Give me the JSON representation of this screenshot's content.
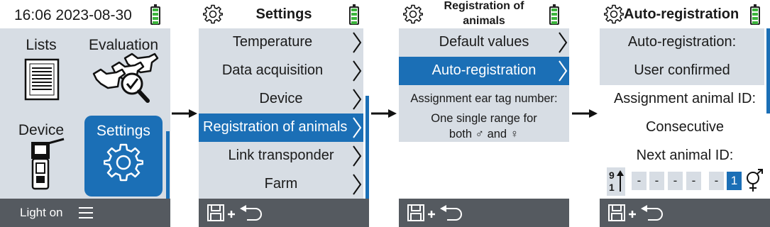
{
  "screen1": {
    "clock": "16:06 2023-08-30",
    "tiles": {
      "lists": "Lists",
      "evaluation": "Evaluation",
      "device": "Device",
      "settings": "Settings"
    },
    "footer_label": "Light on",
    "icons": [
      "battery-icon",
      "list-document-icon",
      "cattle-checkmark-icon",
      "handheld-device-icon",
      "gear-icon",
      "hamburger-menu-icon"
    ]
  },
  "screen2": {
    "title": "Settings",
    "items": [
      {
        "label": "Temperature"
      },
      {
        "label": "Data acquisition"
      },
      {
        "label": "Device"
      },
      {
        "label": "Registration of animals"
      },
      {
        "label": "Link transponder"
      },
      {
        "label": "Farm"
      }
    ],
    "selected_index": 3,
    "icons": [
      "gear-icon",
      "battery-icon",
      "save-icon",
      "plus-icon",
      "back-arrow-icon"
    ]
  },
  "screen3": {
    "title_line1": "Registration of",
    "title_line2": "animals",
    "items": [
      {
        "label": "Default values"
      },
      {
        "label": "Auto-registration"
      }
    ],
    "selected_index": 1,
    "info_line1": "Assignment ear tag number:",
    "info_line2": "One single range for",
    "info_line3": "both ♂ and ♀",
    "icons": [
      "gear-icon",
      "battery-icon",
      "save-icon",
      "plus-icon",
      "back-arrow-icon"
    ]
  },
  "screen4": {
    "title": "Auto-registration",
    "label1": "Auto-registration:",
    "value1": "User confirmed",
    "label2": "Assignment animal ID:",
    "value2": "Consecutive",
    "label3": "Next animal ID:",
    "id_digits": [
      "-",
      "-",
      "-",
      "-",
      "-",
      "1"
    ],
    "sort_icon_text_top": "9",
    "sort_icon_text_bottom": "1",
    "icons": [
      "gear-icon",
      "battery-icon",
      "sort-numeric-icon",
      "gender-symbol-icon",
      "save-icon",
      "plus-icon",
      "back-arrow-icon"
    ]
  },
  "colors": {
    "accent": "#1b6fb6",
    "row_grey": "#d7dde4",
    "footer": "#555a60",
    "battery_green": "#3cb43c"
  }
}
